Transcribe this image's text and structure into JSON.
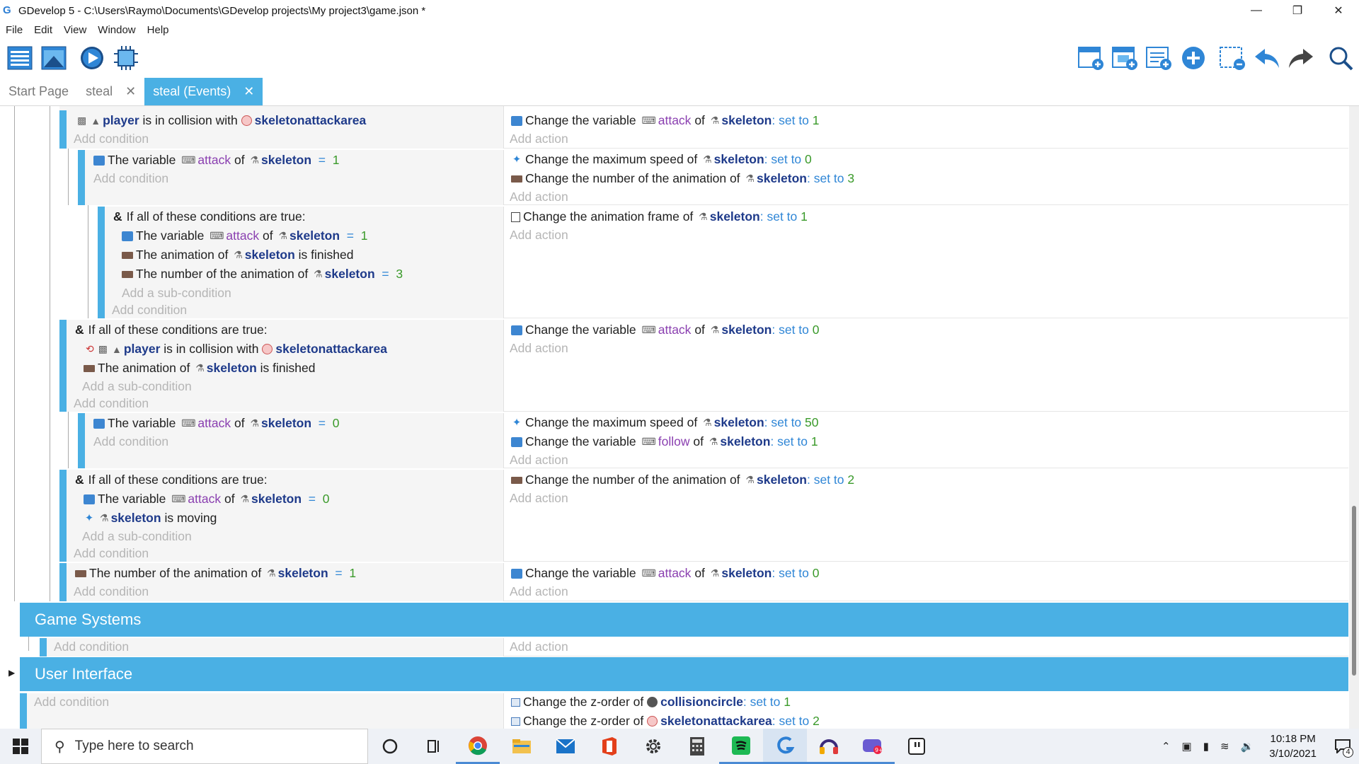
{
  "window": {
    "title": "GDevelop 5 - C:\\Users\\Raymo\\Documents\\GDevelop projects\\My project3\\game.json *",
    "controls": [
      "minimize",
      "restore",
      "close"
    ]
  },
  "menu": [
    "File",
    "Edit",
    "View",
    "Window",
    "Help"
  ],
  "tabs": [
    {
      "label": "Start Page"
    },
    {
      "label": "steal"
    },
    {
      "label": "steal (Events)"
    }
  ],
  "events": {
    "r1": {
      "cond": {
        "obj": "player",
        "t1": "is in collision with",
        "obj2": "skeletonattackarea"
      },
      "act": {
        "pre": "Change the variable",
        "var": "attack",
        "of": "of",
        "obj": "skeleton",
        "sep": ":",
        "op": "set to",
        "val": "1"
      }
    },
    "r2": {
      "cond": {
        "pre": "The variable",
        "var": "attack",
        "of": "of",
        "obj": "skeleton",
        "op": "=",
        "val": "1"
      },
      "act1": {
        "pre": "Change the maximum speed of",
        "obj": "skeleton",
        "op": ": set to",
        "val": "0"
      },
      "act2": {
        "pre": "Change the number of the animation of",
        "obj": "skeleton",
        "op": ": set to",
        "val": "3"
      }
    },
    "r3": {
      "header": "If all of these conditions are true:",
      "c1": {
        "pre": "The variable",
        "var": "attack",
        "of": "of",
        "obj": "skeleton",
        "op": "=",
        "val": "1"
      },
      "c2": {
        "pre": "The animation of",
        "obj": "skeleton",
        "post": "is finished"
      },
      "c3": {
        "pre": "The number of the animation of",
        "obj": "skeleton",
        "op": "=",
        "val": "3"
      },
      "act": {
        "pre": "Change the animation frame of",
        "obj": "skeleton",
        "op": ": set to",
        "val": "1"
      }
    },
    "r4": {
      "header": "If all of these conditions are true:",
      "c1": {
        "obj": "player",
        "t1": "is in collision with",
        "obj2": "skeletonattackarea"
      },
      "c2": {
        "pre": "The animation of",
        "obj": "skeleton",
        "post": "is finished"
      },
      "act": {
        "pre": "Change the variable",
        "var": "attack",
        "of": "of",
        "obj": "skeleton",
        "op": ": set to",
        "val": "0"
      }
    },
    "r5": {
      "cond": {
        "pre": "The variable",
        "var": "attack",
        "of": "of",
        "obj": "skeleton",
        "op": "=",
        "val": "0"
      },
      "act1": {
        "pre": "Change the maximum speed of",
        "obj": "skeleton",
        "op": ": set to",
        "val": "50"
      },
      "act2": {
        "pre": "Change the variable",
        "var": "follow",
        "of": "of",
        "obj": "skeleton",
        "op": ": set to",
        "val": "1"
      }
    },
    "r6": {
      "header": "If all of these conditions are true:",
      "c1": {
        "pre": "The variable",
        "var": "attack",
        "of": "of",
        "obj": "skeleton",
        "op": "=",
        "val": "0"
      },
      "c2": {
        "obj": "skeleton",
        "post": "is moving"
      },
      "act": {
        "pre": "Change the number of the animation of",
        "obj": "skeleton",
        "op": ": set to",
        "val": "2"
      }
    },
    "r7": {
      "cond": {
        "pre": "The number of the animation of",
        "obj": "skeleton",
        "op": "=",
        "val": "1"
      },
      "act": {
        "pre": "Change the variable",
        "var": "attack",
        "of": "of",
        "obj": "skeleton",
        "op": ": set to",
        "val": "0"
      }
    },
    "groups": {
      "g1": "Game Systems",
      "g2": "User Interface"
    },
    "r8": {
      "act1": {
        "pre": "Change the z-order of",
        "obj": "collisioncircle",
        "op": ": set to",
        "val": "1"
      },
      "act2": {
        "pre": "Change the z-order of",
        "obj": "skeletonattackarea",
        "op": ": set to",
        "val": "2"
      }
    },
    "add_condition": "Add condition",
    "add_action": "Add action",
    "add_subcondition": "Add a sub-condition",
    "partial_top": "Add condition"
  },
  "taskbar": {
    "search_placeholder": "Type here to search",
    "time": "10:18 PM",
    "date": "3/10/2021",
    "notifications": "4"
  },
  "colors": {
    "accent": "#4ab0e4",
    "object": "#1e3a8a",
    "variable": "#8a3fb0",
    "operator": "#2f86d6",
    "value": "#3a9a2a"
  }
}
